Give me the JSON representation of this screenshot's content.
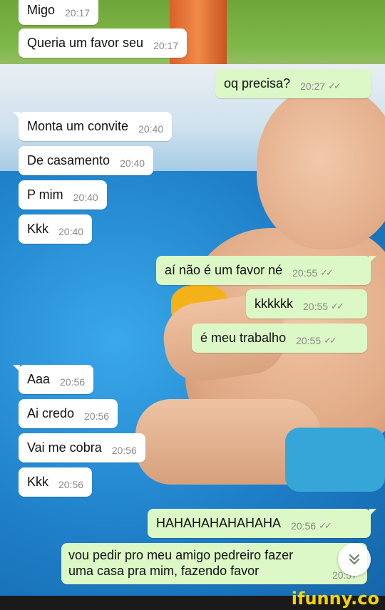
{
  "messages": [
    {
      "text": "Migo",
      "time": "20:17",
      "side": "in"
    },
    {
      "text": "Queria um favor seu",
      "time": "20:17",
      "side": "in"
    },
    {
      "text": "oq precisa?",
      "time": "20:27",
      "side": "out",
      "status": "✓✓"
    },
    {
      "text": "Monta um convite",
      "time": "20:40",
      "side": "in"
    },
    {
      "text": "De casamento",
      "time": "20:40",
      "side": "in"
    },
    {
      "text": "P mim",
      "time": "20:40",
      "side": "in"
    },
    {
      "text": "Kkk",
      "time": "20:40",
      "side": "in"
    },
    {
      "text": "aí não é um favor né",
      "time": "20:55",
      "side": "out",
      "status": "✓✓"
    },
    {
      "text": "kkkkkk",
      "time": "20:55",
      "side": "out",
      "status": "✓✓"
    },
    {
      "text": "é meu trabalho",
      "time": "20:55",
      "side": "out",
      "status": "✓✓"
    },
    {
      "text": "Aaa",
      "time": "20:56",
      "side": "in"
    },
    {
      "text": "Ai credo",
      "time": "20:56",
      "side": "in"
    },
    {
      "text": "Vai me cobra",
      "time": "20:56",
      "side": "in"
    },
    {
      "text": "Kkk",
      "time": "20:56",
      "side": "in"
    },
    {
      "text": "HAHAHAHAHAHAHA",
      "time": "20:56",
      "side": "out",
      "status": "✓✓"
    },
    {
      "lines": [
        "vou pedir pro meu amigo pedreiro fazer",
        "uma casa pra mim, fazendo favor"
      ],
      "time": "20:57",
      "side": "out"
    }
  ],
  "scroll_button": {
    "icon": "chevron-double-down-icon",
    "glyph": "⌄⌄"
  },
  "watermark": "ifunny.co",
  "colors": {
    "incoming": "#ffffff",
    "outgoing": "#dcf8c6",
    "timestamp": "#8a8a8a",
    "watermark": "#f5d400"
  }
}
